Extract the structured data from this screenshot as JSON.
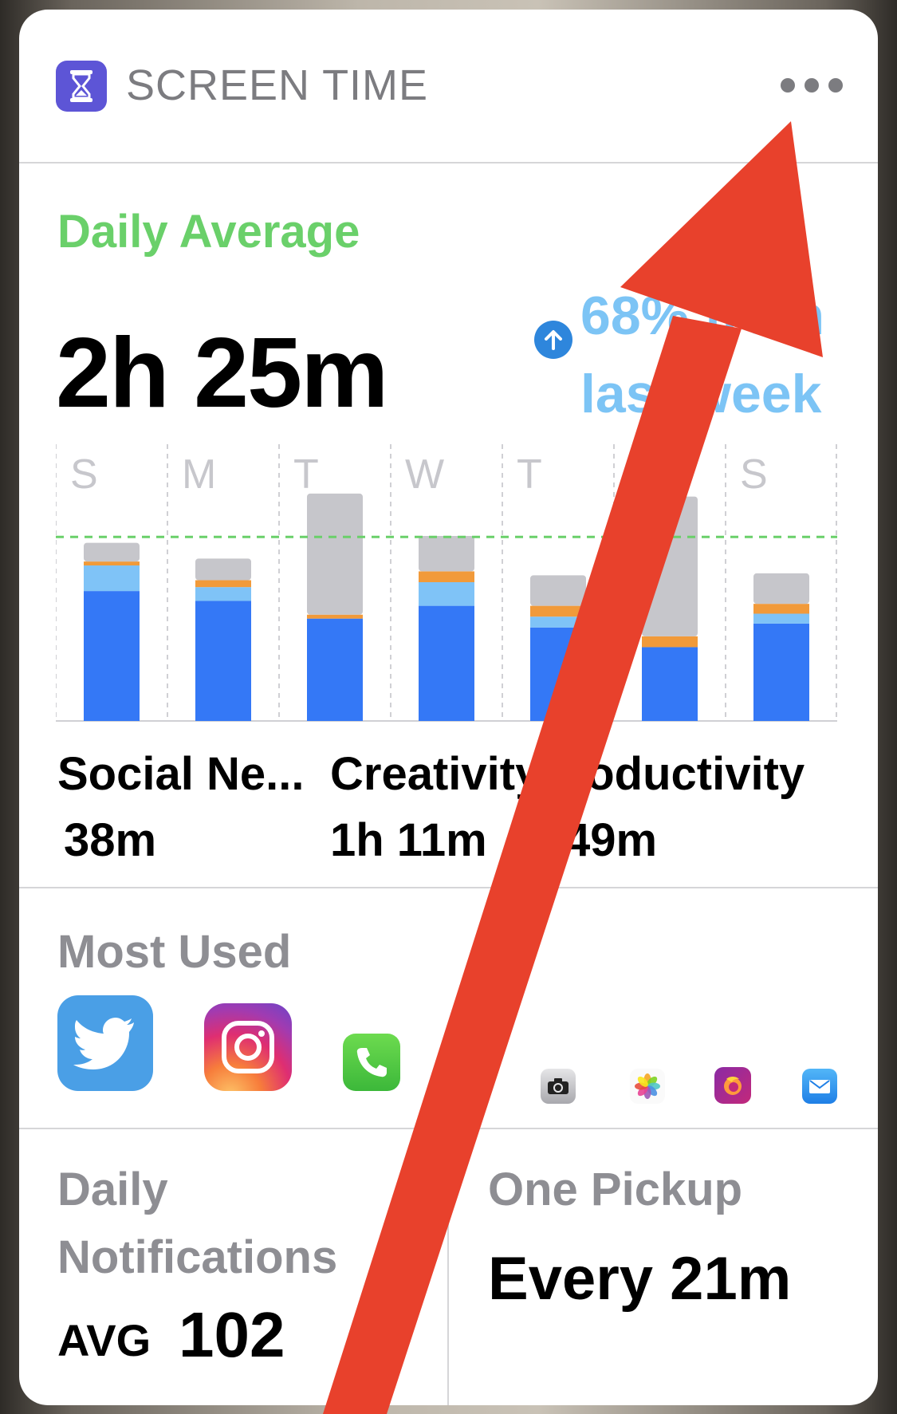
{
  "header": {
    "title": "SCREEN TIME",
    "more_label": "more-options"
  },
  "summary": {
    "label": "Daily Average",
    "value": "2h 25m",
    "trend_text": "68% from last week",
    "trend_direction": "up"
  },
  "chart_data": {
    "type": "bar",
    "categories": [
      "S",
      "M",
      "T",
      "W",
      "T",
      "F",
      "S"
    ],
    "series": [
      {
        "name": "Social Networking",
        "values": [
          132,
          122,
          104,
          117,
          95,
          75,
          99
        ]
      },
      {
        "name": "Creativity",
        "values": [
          26,
          14,
          0,
          24,
          11,
          0,
          10
        ]
      },
      {
        "name": "Productivity",
        "values": [
          4,
          7,
          4,
          11,
          11,
          11,
          10
        ]
      },
      {
        "name": "Other",
        "values": [
          19,
          22,
          123,
          36,
          31,
          142,
          31
        ]
      }
    ],
    "average": 187,
    "ylim": [
      0,
      235
    ],
    "colors": {
      "Social Networking": "#3478f6",
      "Creativity": "#7fc3f7",
      "Productivity": "#f19a3a",
      "Other": "#c6c6cb",
      "average_line": "#6ad06a"
    }
  },
  "categories": [
    {
      "name": "Social Ne...",
      "time": "38m",
      "color": "#3478f6"
    },
    {
      "name": "Creativity",
      "time": "1h 11m",
      "color": "#7fc3f7"
    },
    {
      "name": "Productivity",
      "time": "49m",
      "color": "#f19a3a"
    }
  ],
  "most_used": {
    "label": "Most Used",
    "apps": [
      {
        "name": "twitter-icon"
      },
      {
        "name": "instagram-icon"
      },
      {
        "name": "phone-icon"
      },
      {
        "name": "messages-icon"
      },
      {
        "name": "camera-icon"
      },
      {
        "name": "photos-icon"
      },
      {
        "name": "firefox-icon"
      },
      {
        "name": "mail-icon"
      }
    ]
  },
  "stats": {
    "notifications": {
      "label_line1": "Daily",
      "label_line2": "Notifications",
      "prefix": "AVG",
      "value": "102"
    },
    "pickups": {
      "label": "One Pickup",
      "value": "Every 21m"
    }
  }
}
